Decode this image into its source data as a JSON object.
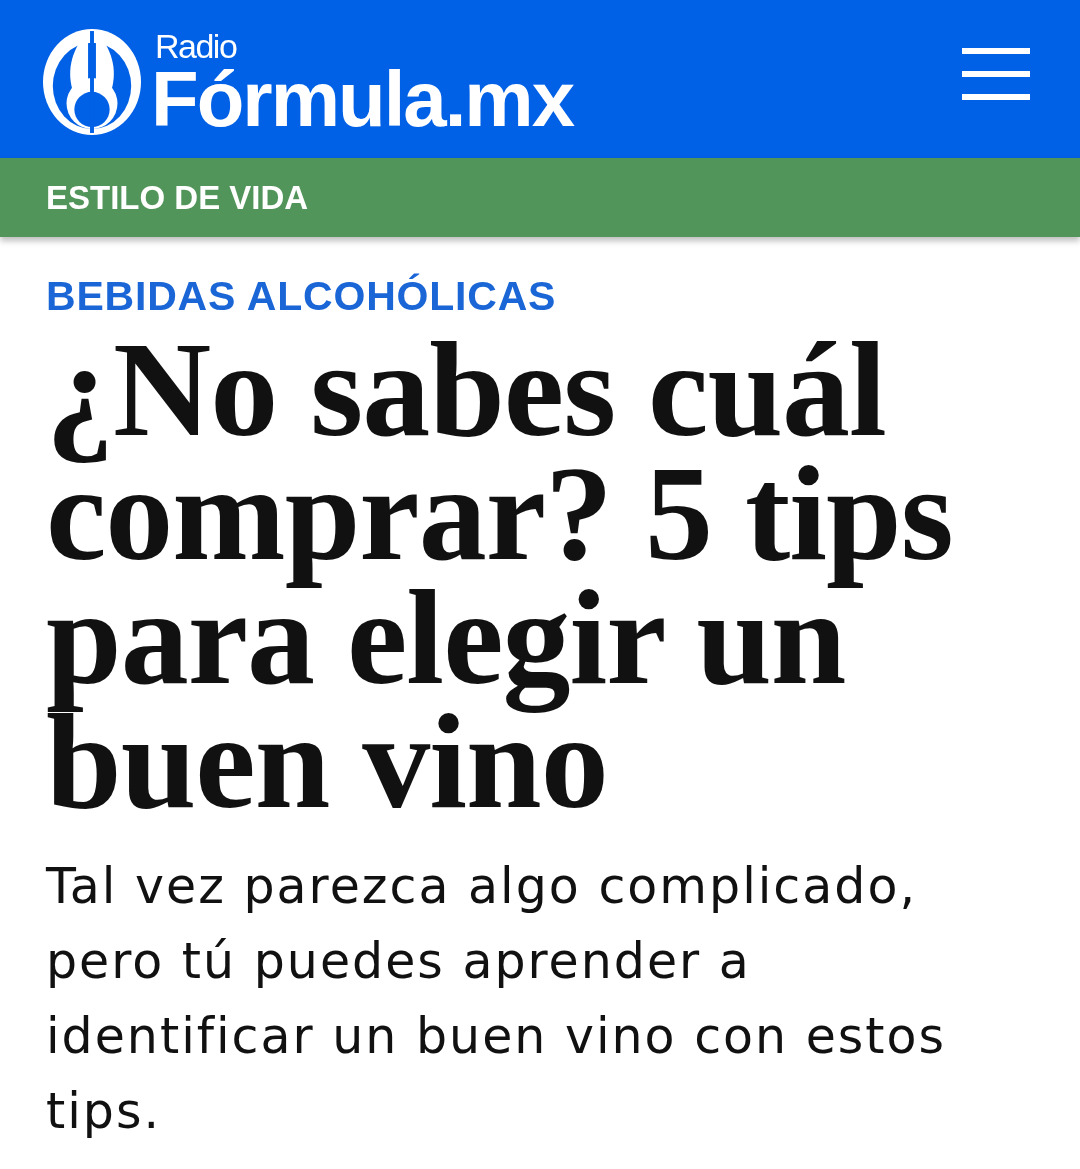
{
  "header": {
    "logo": {
      "top_text": "Radio",
      "name": "Fórmula.mx"
    }
  },
  "section_bar": {
    "label": "ESTILO DE VIDA"
  },
  "article": {
    "category": "BEBIDAS ALCOHÓLICAS",
    "headline": "¿No sabes cuál comprar? 5 tips para elegir un buen vino",
    "summary": "Tal vez parezca algo complicado, pero tú puedes aprender a identificar un buen vino con estos tips."
  }
}
